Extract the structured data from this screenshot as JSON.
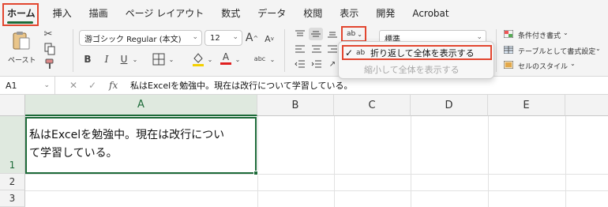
{
  "tabs": [
    "ホーム",
    "挿入",
    "描画",
    "ページ レイアウト",
    "数式",
    "データ",
    "校閲",
    "表示",
    "開発",
    "Acrobat"
  ],
  "ribbon": {
    "paste_label": "ペースト",
    "font_name": "游ゴシック Regular (本文)",
    "font_size": "12",
    "number_format": "標準",
    "styles": {
      "conditional": "条件付き書式",
      "table": "テーブルとして書式設定",
      "cell_style": "セルのスタイル"
    },
    "bold": "B",
    "italic": "I",
    "underline": "U",
    "grow_font": "A",
    "shrink_font": "A",
    "font_color_letter": "A",
    "phonetic": "abc",
    "wrap_icon_text": "ab"
  },
  "wrap_menu": {
    "wrap_text": "折り返して全体を表示する",
    "shrink_to_fit": "縮小して全体を表示する",
    "check": "✓"
  },
  "formula_bar": {
    "name_box": "A1",
    "fx": "fx",
    "content": "私はExcelを勉強中。現在は改行について学習している。"
  },
  "grid": {
    "columns": [
      "A",
      "B",
      "C",
      "D",
      "E"
    ],
    "rows": [
      "1",
      "2",
      "3"
    ],
    "a1_line1": "私はExcelを勉強中。現在は改行につい",
    "a1_line2": "て学習している。"
  },
  "colors": {
    "accent": "#1d6b39",
    "highlight": "#e2462f",
    "font_color_bar": "#e02020",
    "fill_color_bar": "#f4d000"
  }
}
